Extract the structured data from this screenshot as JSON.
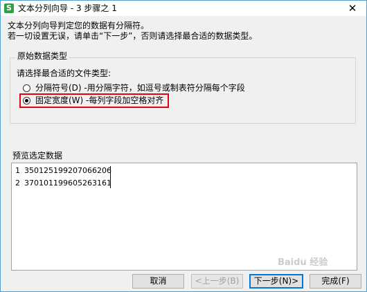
{
  "window": {
    "title": "文本分列向导 - 3 步骤之 1",
    "app_icon": "S",
    "close_glyph": "✕"
  },
  "description": {
    "line1": "文本分列向导判定您的数据有分隔符。",
    "line2": "若一切设置无误，请单击“下一步”，否则请选择最合适的数据类型。"
  },
  "group": {
    "legend": "原始数据类型",
    "prompt": "请选择最合适的文件类型:",
    "options": [
      {
        "label": "分隔符号(D)  -用分隔字符，如逗号或制表符分隔每个字段",
        "checked": false
      },
      {
        "label": "固定宽度(W)  -每列字段加空格对齐",
        "checked": true
      }
    ]
  },
  "preview": {
    "label": "预览选定数据",
    "rows": [
      {
        "num": "1",
        "value": "350125199207066206"
      },
      {
        "num": "2",
        "value": "370101199605263161"
      }
    ]
  },
  "buttons": {
    "cancel": "取消",
    "back": "<上一步(B)",
    "next": "下一步(N)>",
    "finish": "完成(F)"
  },
  "watermark": "Baidu 经验",
  "colors": {
    "highlight": "#e3000f",
    "accent": "#0078d7",
    "app_icon": "#2ea043"
  }
}
